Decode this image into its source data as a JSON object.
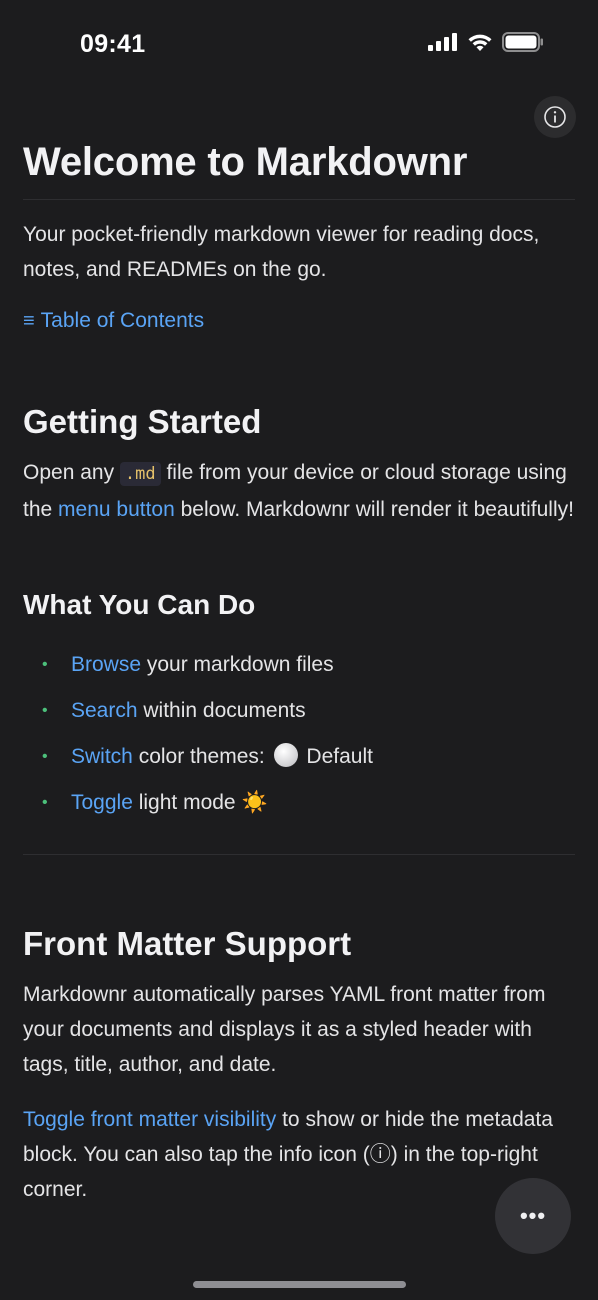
{
  "status_bar": {
    "time": "09:41"
  },
  "header": {
    "info_icon": "info-circle-icon"
  },
  "doc": {
    "title": "Welcome to Markdownr",
    "intro": "Your pocket-friendly markdown viewer for reading docs, notes, and READMEs on the go.",
    "toc_icon": "≡",
    "toc_label": "Table of Contents",
    "getting_started": {
      "heading": "Getting Started",
      "text_before_code": "Open any ",
      "code": ".md",
      "text_after_code": " file from your device or cloud storage using the ",
      "link": "menu button",
      "text_end": " below. Markdownr will render it beautifully!"
    },
    "what_you_can_do": {
      "heading": "What You Can Do",
      "items": [
        {
          "link": "Browse",
          "rest": " your markdown files"
        },
        {
          "link": "Search",
          "rest": " within documents"
        },
        {
          "link": "Switch",
          "rest_before": " color themes: ",
          "rest_after": " Default"
        },
        {
          "link": "Toggle",
          "rest": " light mode ",
          "emoji": "☀️"
        }
      ]
    },
    "front_matter": {
      "heading": "Front Matter Support",
      "para1": "Markdownr automatically parses YAML front matter from your documents and displays it as a styled header with tags, title, author, and date.",
      "link": "Toggle front matter visibility",
      "para2_rest": " to show or hide the metadata block. You can also tap the info icon (ⓘ) in the top-right corner."
    }
  },
  "fab": {
    "label": "•••"
  },
  "colors": {
    "accent": "#5aa4f5",
    "bullet": "#4cc07b",
    "background": "#1c1c1e"
  }
}
